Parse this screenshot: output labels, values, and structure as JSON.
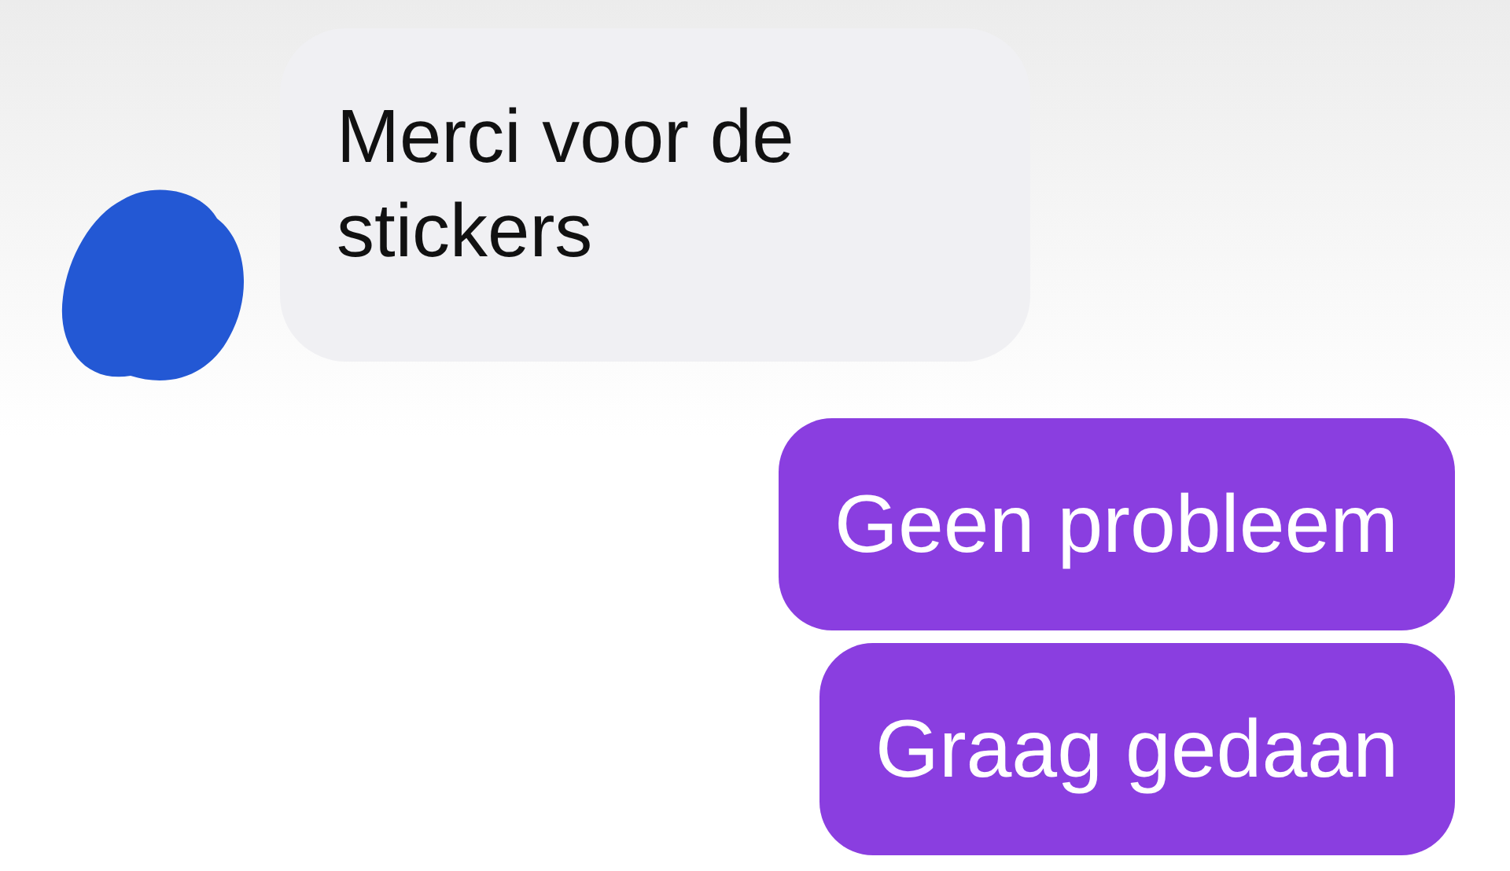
{
  "messages": [
    {
      "kind": "incoming",
      "text": "Merci voor de stickers"
    },
    {
      "kind": "outgoing",
      "text": "Geen probleem"
    },
    {
      "kind": "outgoing",
      "text": "Graag gedaan"
    }
  ]
}
